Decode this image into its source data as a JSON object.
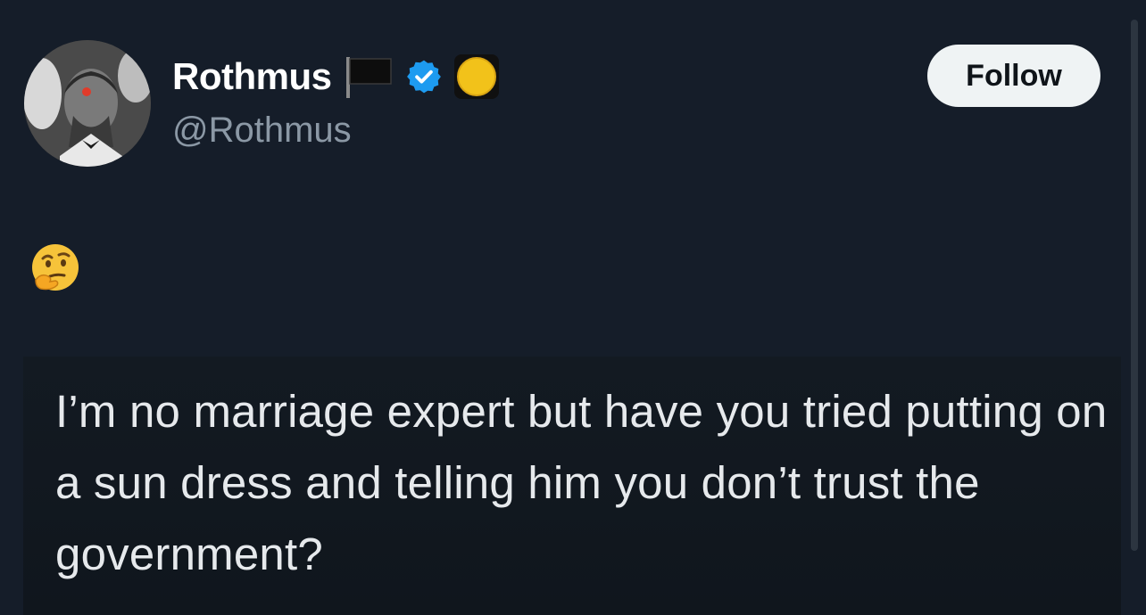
{
  "author": {
    "display_name": "Rothmus",
    "handle": "@Rothmus",
    "avatar_icon": "profile-avatar",
    "badges": [
      "black-flag-icon",
      "verified-badge-icon",
      "yellow-coin-icon"
    ]
  },
  "actions": {
    "follow_label": "Follow"
  },
  "tweet": {
    "emoji_icon": "thinking-face-emoji"
  },
  "embedded_image": {
    "text": "I’m no marriage expert but have you tried putting on a sun dress and telling him you don’t trust the government?"
  },
  "colors": {
    "background": "#151d29",
    "verified_blue": "#1d9bf0",
    "follow_bg": "#eff3f4",
    "handle_gray": "#8b98a5"
  }
}
